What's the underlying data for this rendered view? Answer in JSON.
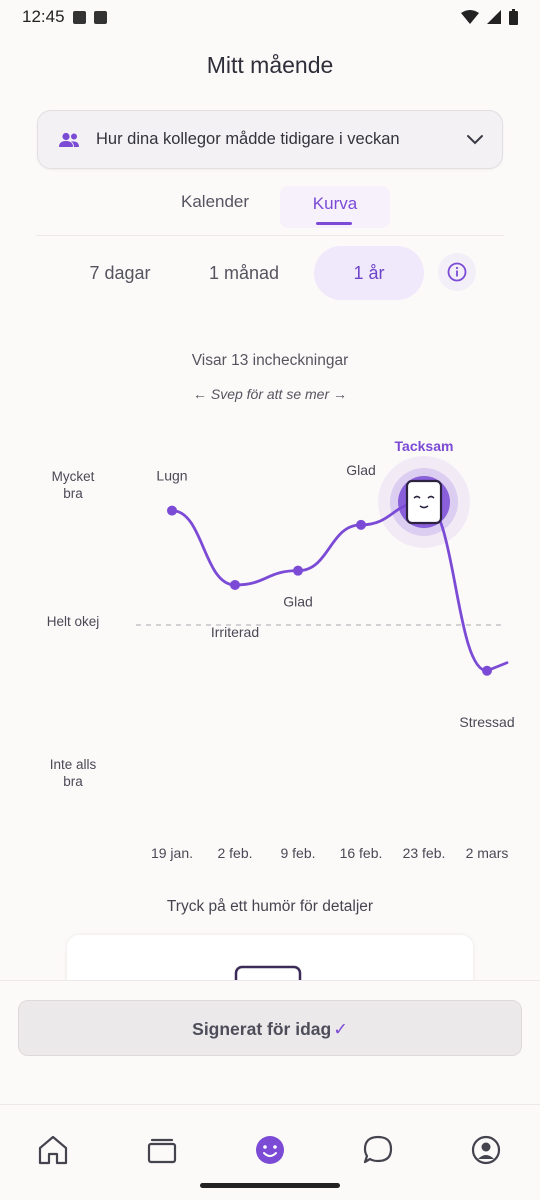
{
  "status": {
    "time": "12:45"
  },
  "header": {
    "title": "Mitt mående"
  },
  "colleagues": {
    "label": "Hur dina kollegor mådde tidigare i veckan",
    "icon": "people-icon"
  },
  "tabs": [
    {
      "label": "Kalender"
    },
    {
      "label": "Kurva",
      "active": true
    }
  ],
  "ranges": [
    {
      "label": "7 dagar"
    },
    {
      "label": "1 månad"
    },
    {
      "label": "1 år",
      "active": true
    }
  ],
  "checkins": {
    "count_text": "Visar 13 incheckningar",
    "swipe_text": "← Svep för att se mer →"
  },
  "chart_data": {
    "type": "line",
    "y_levels": [
      "Mycket bra",
      "Helt okej",
      "Inte alls bra"
    ],
    "x": [
      "19 jan.",
      "2 feb.",
      "9 feb.",
      "16 feb.",
      "23 feb.",
      "2 mars"
    ],
    "points": [
      {
        "label": "Lugn",
        "value": 0.8
      },
      {
        "label": "Irriterad",
        "value": 0.28
      },
      {
        "label": "Glad",
        "value": 0.38
      },
      {
        "label": "Glad",
        "value": 0.7
      },
      {
        "label": "Tacksam",
        "value": 0.86
      },
      {
        "label": "Stressad",
        "value": -0.32
      }
    ],
    "highlight": "Tacksam",
    "color": "#7b4bd6"
  },
  "hint": "Tryck på ett humör för detaljer",
  "sign": {
    "label": "Signerat för idag",
    "check": "✓"
  },
  "nav": [
    {
      "icon": "home-icon"
    },
    {
      "icon": "cards-icon"
    },
    {
      "icon": "mood-icon",
      "active": true
    },
    {
      "icon": "chat-icon"
    },
    {
      "icon": "profile-icon"
    }
  ]
}
